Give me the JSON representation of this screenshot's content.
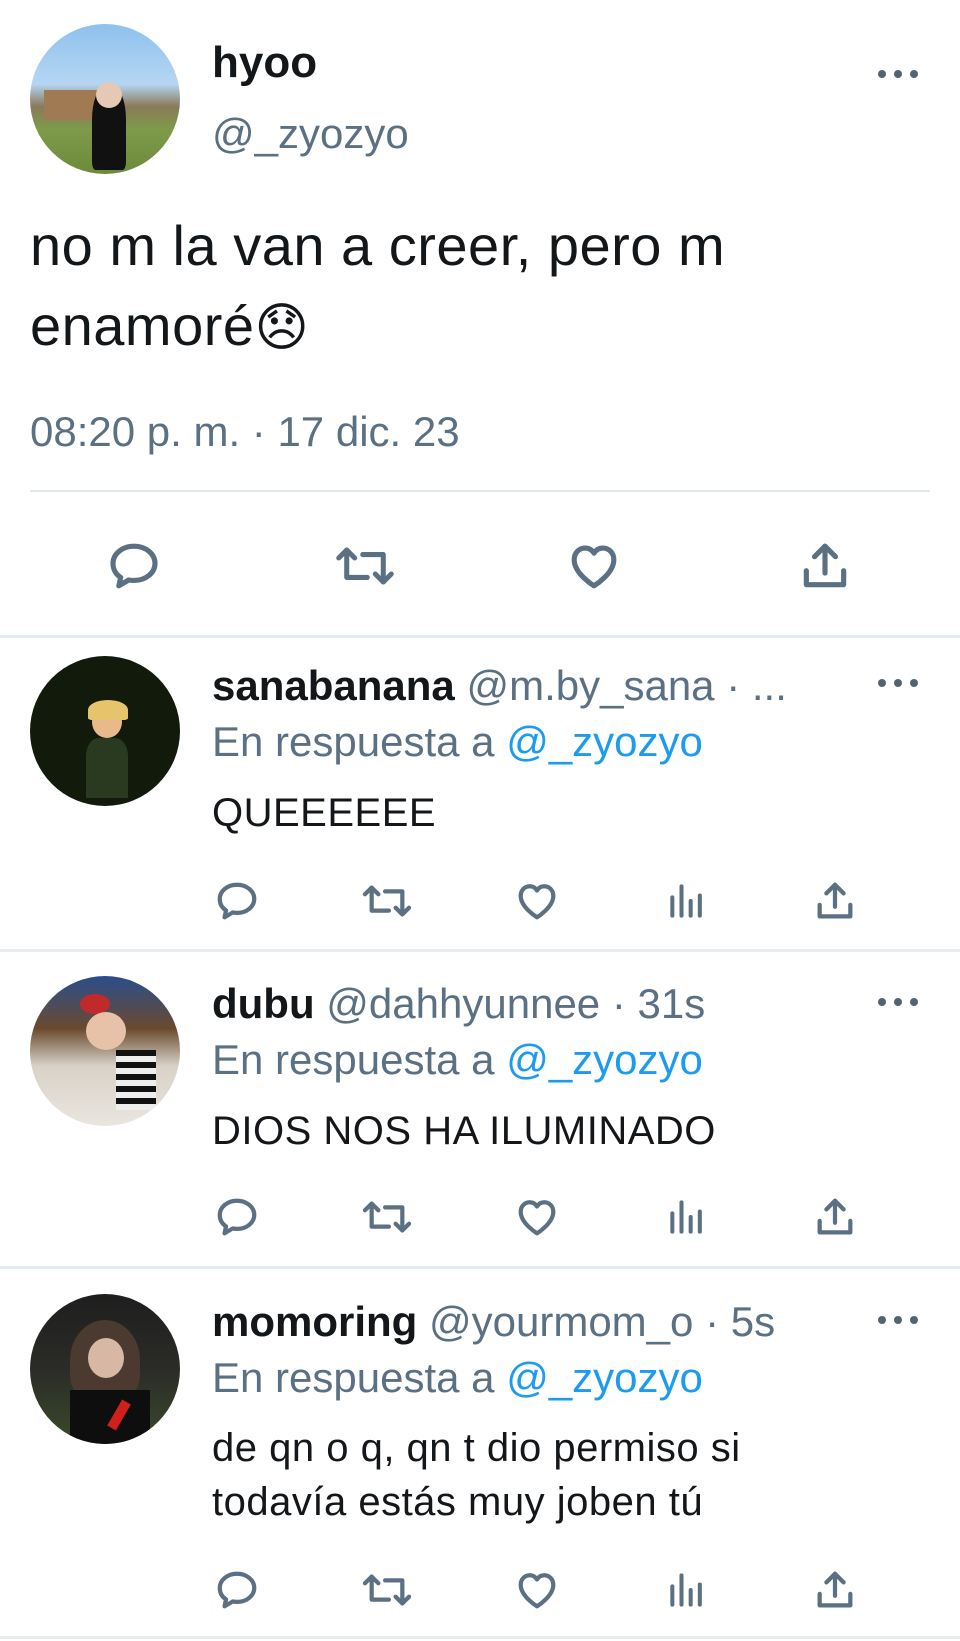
{
  "main_tweet": {
    "display_name": "hyoo",
    "handle": "@_zyozyo",
    "text": "no m la van a creer, pero m enamoré",
    "emoji": "😞",
    "timestamp": "08:20 p. m. · 17 dic. 23",
    "actions": [
      "reply-icon",
      "retweet-icon",
      "like-icon",
      "share-icon"
    ]
  },
  "replies": [
    {
      "display_name": "sanabanana",
      "handle": "@m.by_sana",
      "time": "· ...",
      "replying_to_label": "En respuesta a",
      "replying_to": "@_zyozyo",
      "text": "QUEEEEEE"
    },
    {
      "display_name": "dubu",
      "handle": "@dahhyunnee",
      "time": "· 31s",
      "replying_to_label": "En respuesta a",
      "replying_to": "@_zyozyo",
      "text": "DIOS NOS HA ILUMINADO"
    },
    {
      "display_name": "momoring",
      "handle": "@yourmom_o",
      "time": "· 5s",
      "replying_to_label": "En respuesta a",
      "replying_to": "@_zyozyo",
      "text": "de qn o q, qn t dio permiso si todavía estás muy joben tú"
    }
  ],
  "colors": {
    "accent": "#1d9bf0",
    "muted": "#5b7083",
    "text": "#14171a"
  }
}
